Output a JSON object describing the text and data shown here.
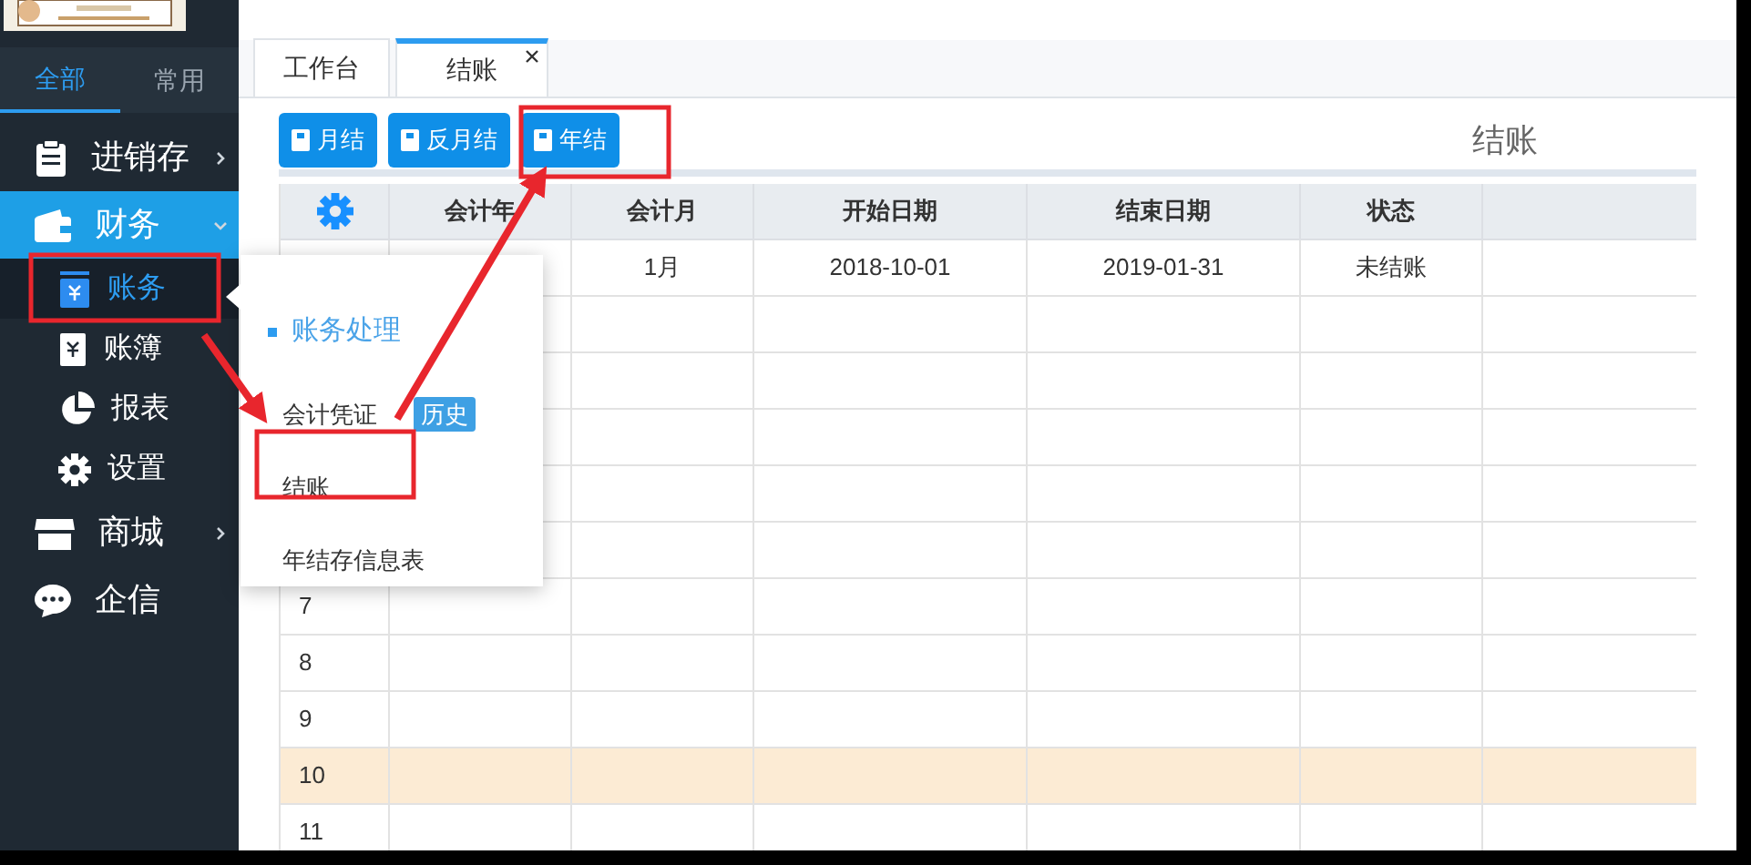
{
  "sidebar": {
    "tabs": [
      {
        "label": "全部",
        "selected": true
      },
      {
        "label": "常用",
        "selected": false
      }
    ],
    "items": [
      {
        "label": "进销存",
        "kind": "group",
        "expanded": false,
        "selected": false
      },
      {
        "label": "财务",
        "kind": "group",
        "expanded": true,
        "selected": true,
        "children": [
          {
            "label": "账务",
            "selected": true
          },
          {
            "label": "账簿",
            "selected": false
          },
          {
            "label": "报表",
            "selected": false
          },
          {
            "label": "设置",
            "selected": false
          }
        ]
      },
      {
        "label": "商城",
        "kind": "group",
        "expanded": false,
        "selected": false
      },
      {
        "label": "企信",
        "kind": "link",
        "selected": false
      }
    ]
  },
  "tabs": [
    {
      "label": "工作台",
      "selected": false,
      "closable": false
    },
    {
      "label": "结账",
      "selected": true,
      "closable": true
    }
  ],
  "toolbar": {
    "buttons": [
      "月结",
      "反月结",
      "年结"
    ],
    "heading": "结账"
  },
  "table": {
    "columns": [
      "会计年",
      "会计月",
      "开始日期",
      "结束日期",
      "状态"
    ],
    "rows": [
      {
        "cells": [
          "",
          "1月",
          "2018-10-01",
          "2019-01-31",
          "未结账"
        ],
        "selected": false
      },
      {
        "cells": [
          "",
          "",
          "",
          "",
          ""
        ],
        "selected": false
      },
      {
        "cells": [
          "",
          "",
          "",
          "",
          ""
        ],
        "selected": false
      },
      {
        "cells": [
          "",
          "",
          "",
          "",
          ""
        ],
        "selected": false
      },
      {
        "cells": [
          "",
          "",
          "",
          "",
          ""
        ],
        "selected": false
      },
      {
        "cells": [
          "",
          "",
          "",
          "",
          ""
        ],
        "selected": false
      },
      {
        "row_number": "7",
        "cells": [
          "",
          "",
          "",
          "",
          ""
        ],
        "selected": false
      },
      {
        "row_number": "8",
        "cells": [
          "",
          "",
          "",
          "",
          ""
        ],
        "selected": false
      },
      {
        "row_number": "9",
        "cells": [
          "",
          "",
          "",
          "",
          ""
        ],
        "selected": false
      },
      {
        "row_number": "10",
        "cells": [
          "",
          "",
          "",
          "",
          ""
        ],
        "selected": true
      },
      {
        "row_number": "11",
        "cells": [
          "",
          "",
          "",
          "",
          ""
        ],
        "selected": false
      }
    ]
  },
  "popup": {
    "heading": "账务处理",
    "items": [
      {
        "label": "会计凭证",
        "badge": "历史"
      },
      {
        "label": "结账"
      },
      {
        "label": "年结存信息表"
      }
    ]
  }
}
